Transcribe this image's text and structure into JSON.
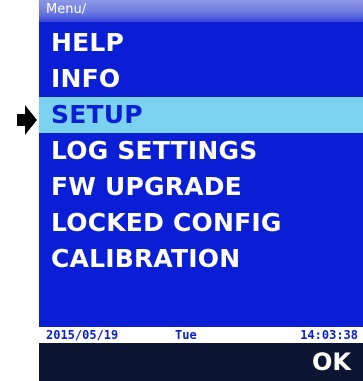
{
  "breadcrumb": "Menu/",
  "menu": {
    "items": [
      {
        "label": "HELP"
      },
      {
        "label": "INFO"
      },
      {
        "label": "SETUP"
      },
      {
        "label": "LOG  SETTINGS"
      },
      {
        "label": "FW  UPGRADE"
      },
      {
        "label": "LOCKED  CONFIG"
      },
      {
        "label": "CALIBRATION"
      }
    ],
    "selected_label": "SETUP"
  },
  "status": {
    "date": "2015/05/19",
    "day": "Tue",
    "time": "14:03:38"
  },
  "softkey": {
    "ok_label": "OK"
  },
  "colors": {
    "screen_background": "#0a1ed6",
    "selected_background": "#7ad2f0",
    "softkey_background": "#0c1632",
    "text": "#ffffff"
  },
  "icons": {
    "selection_pointer": "arrow-right-icon"
  }
}
